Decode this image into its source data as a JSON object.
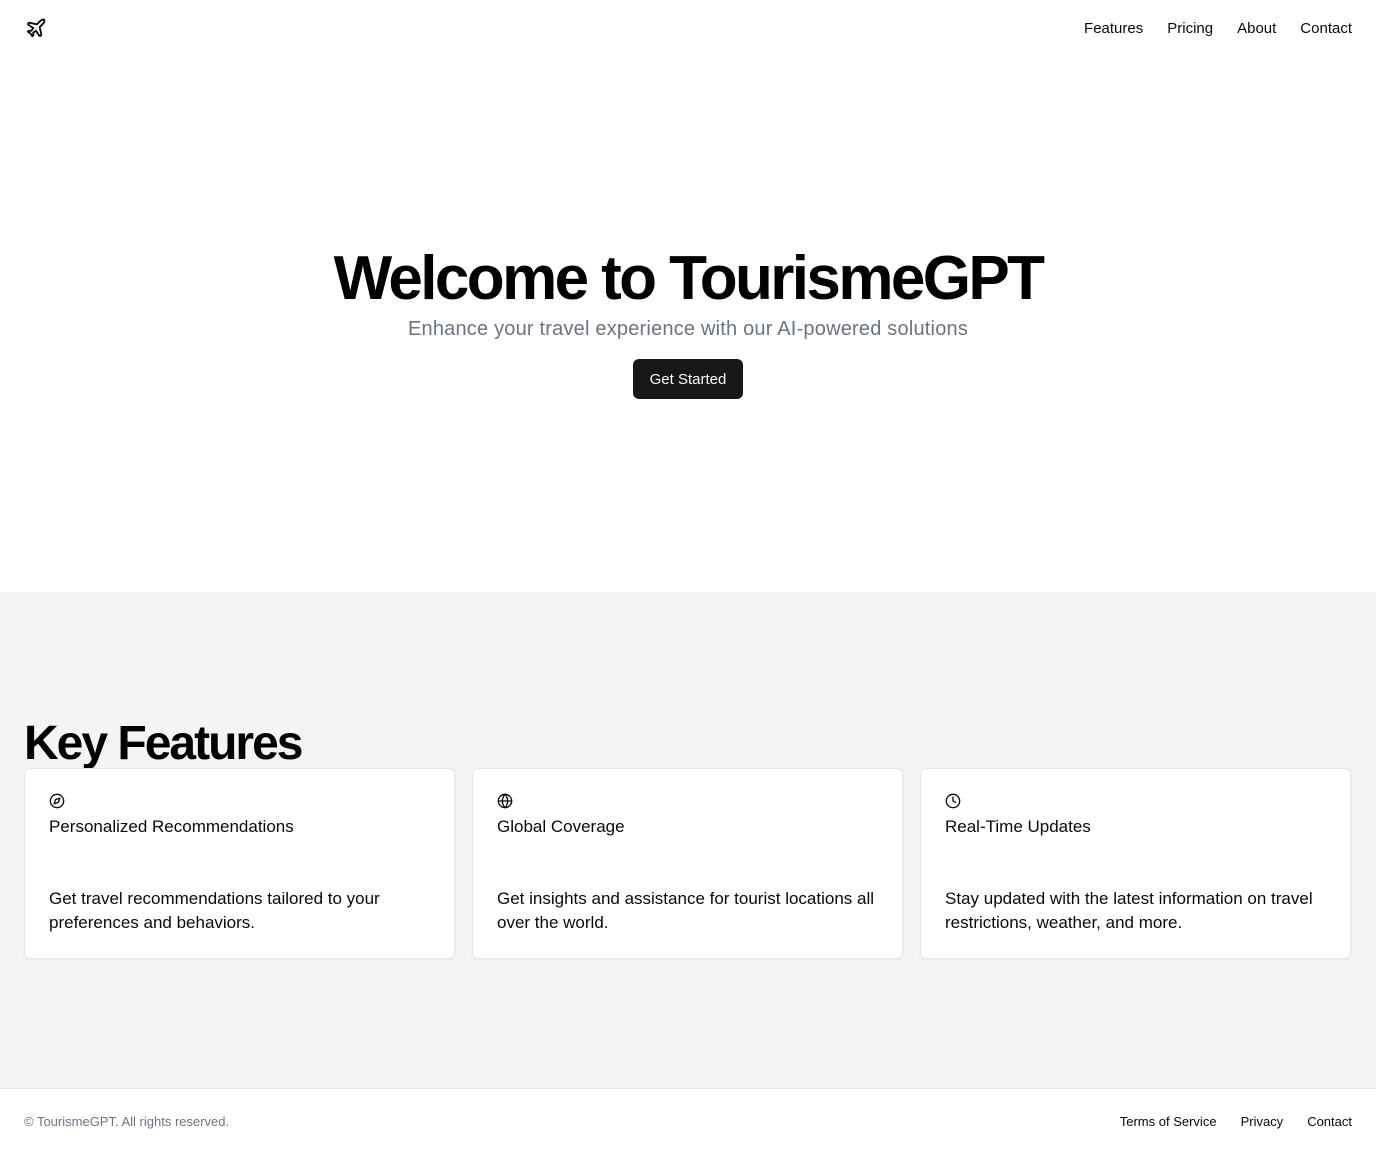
{
  "header": {
    "logo_icon": "plane-icon",
    "nav": [
      "Features",
      "Pricing",
      "About",
      "Contact"
    ]
  },
  "hero": {
    "title": "Welcome to TourismeGPT",
    "subtitle": "Enhance your travel experience with our AI-powered solutions",
    "cta_label": "Get Started"
  },
  "features": {
    "heading": "Key Features",
    "cards": [
      {
        "icon": "compass-icon",
        "title": "Personalized Recommendations",
        "description": "Get travel recommendations tailored to your preferences and behaviors."
      },
      {
        "icon": "globe-icon",
        "title": "Global Coverage",
        "description": "Get insights and assistance for tourist locations all over the world."
      },
      {
        "icon": "clock-icon",
        "title": "Real-Time Updates",
        "description": "Stay updated with the latest information on travel restrictions, weather, and more."
      }
    ]
  },
  "footer": {
    "copyright": "© TourismeGPT. All rights reserved.",
    "links": [
      "Terms of Service",
      "Privacy",
      "Contact"
    ]
  },
  "colors": {
    "primary_button": "#18181b",
    "muted_text": "#6b7280",
    "section_background": "#f3f4f6"
  }
}
